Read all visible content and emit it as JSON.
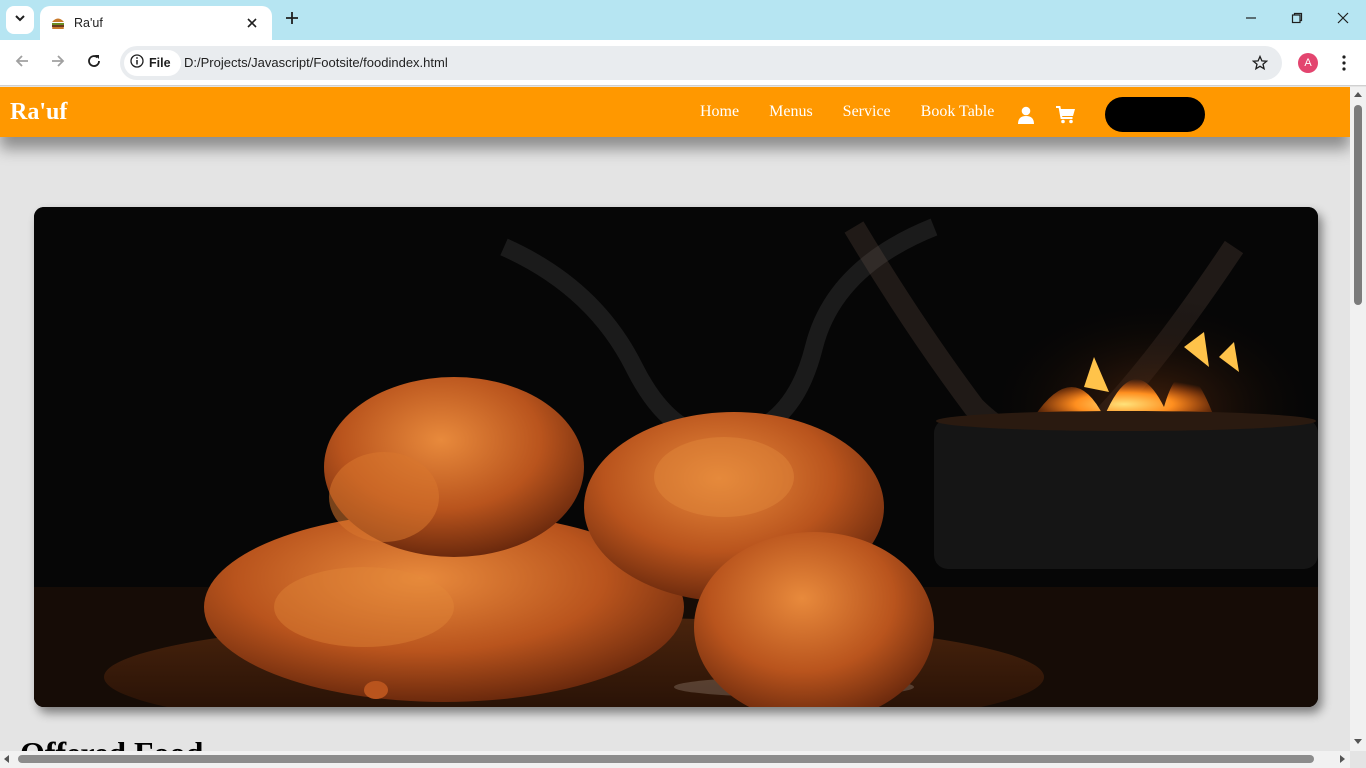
{
  "browser": {
    "tab_title": "Ra'uf",
    "site_chip_label": "File",
    "url": "D:/Projects/Javascript/Footsite/foodindex.html",
    "profile_initial": "A",
    "icons": [
      "tab-search-icon",
      "food-favicon-icon",
      "close-icon",
      "plus-icon",
      "minimize-icon",
      "restore-icon",
      "window-close-icon",
      "back-arrow-icon",
      "forward-arrow-icon",
      "reload-icon",
      "info-icon",
      "star-icon",
      "more-vert-icon"
    ]
  },
  "site": {
    "brand": "Ra'uf",
    "nav": {
      "home": "Home",
      "menus": "Menus",
      "service": "Service",
      "book_table": "Book Table"
    },
    "nav_icons": [
      "user-icon",
      "cart-icon"
    ],
    "section_title": "Offered Food"
  },
  "colors": {
    "nav_background": "#ff9800",
    "page_background": "#e4e4e4",
    "tabstrip_background": "#b6e5f2",
    "profile_avatar": "#e3456f"
  }
}
